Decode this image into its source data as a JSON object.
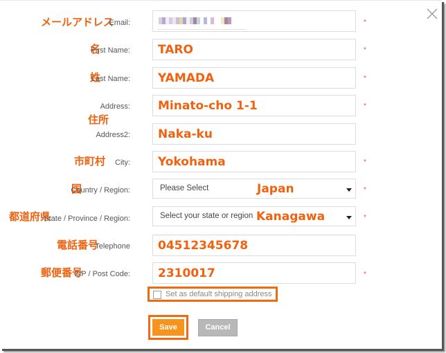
{
  "dialog": {
    "close_icon": "close-x-icon"
  },
  "form": {
    "email": {
      "jp_label": "メールアドレス",
      "label": "Email:",
      "value": "(blurred)",
      "required_mark": "*"
    },
    "first_name": {
      "jp_label": "名",
      "label": "First Name:",
      "value": "TARO",
      "required_mark": "*"
    },
    "last_name": {
      "jp_label": "姓",
      "label": "Last Name:",
      "value": "YAMADA",
      "required_mark": "*"
    },
    "address": {
      "jp_label": "住所",
      "label": "Address:",
      "value": "Minato-cho 1-1",
      "required_mark": "*"
    },
    "address2": {
      "label": "Address2:",
      "value": "Naka-ku"
    },
    "city": {
      "jp_label": "市町村",
      "label": "City:",
      "value": "Yokohama",
      "required_mark": "*"
    },
    "country": {
      "jp_label": "国",
      "label": "Country / Region:",
      "placeholder": "Please Select",
      "value": "Japan",
      "required_mark": "*"
    },
    "state": {
      "jp_label": "都道府県",
      "label": "State / Province / Region:",
      "placeholder": "Select your state or region",
      "value": "Kanagawa",
      "required_mark": "*"
    },
    "telephone": {
      "jp_label": "電話番号",
      "label": "Telephone",
      "value": "04512345678"
    },
    "zip": {
      "jp_label": "郵便番号",
      "label": "ZIP / Post Code:",
      "value": "2310017",
      "required_mark": "*"
    },
    "default_shipping": {
      "label": "Set as default shipping address",
      "checked": false
    }
  },
  "buttons": {
    "save": "Save",
    "cancel": "Cancel"
  },
  "colors": {
    "annotation_orange": "#f0620f",
    "save_button": "#f7941d",
    "cancel_button": "#b8b8b8",
    "required_mark": "#ef4b6a",
    "highlight_border": "#f06b0f"
  }
}
